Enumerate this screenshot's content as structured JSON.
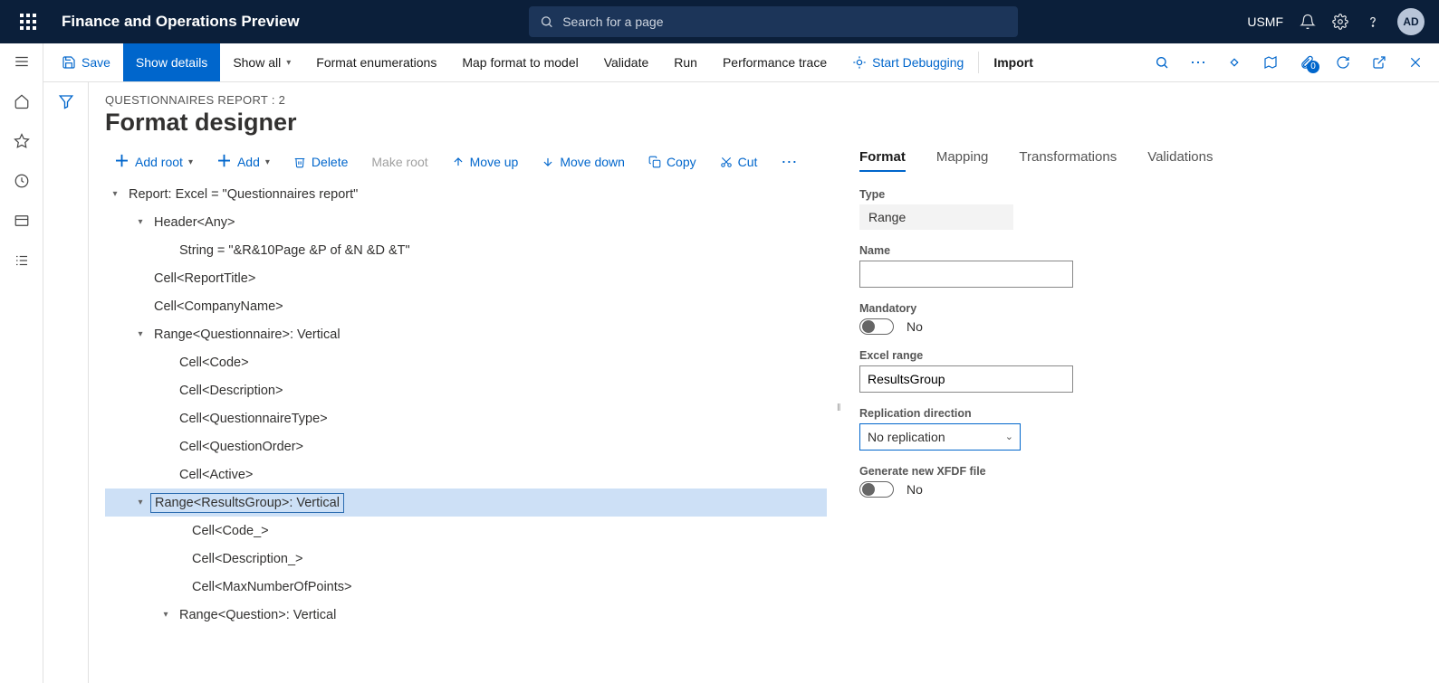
{
  "header": {
    "app_title": "Finance and Operations Preview",
    "search_placeholder": "Search for a page",
    "company": "USMF",
    "avatar": "AD"
  },
  "commandbar": {
    "save": "Save",
    "show_details": "Show details",
    "show_all": "Show all",
    "format_enum": "Format enumerations",
    "map_format": "Map format to model",
    "validate": "Validate",
    "run": "Run",
    "perf_trace": "Performance trace",
    "start_debug": "Start Debugging",
    "import": "Import",
    "attach_count": "0"
  },
  "page": {
    "breadcrumb": "QUESTIONNAIRES REPORT : 2",
    "title": "Format designer"
  },
  "tree_toolbar": {
    "add_root": "Add root",
    "add": "Add",
    "delete": "Delete",
    "make_root": "Make root",
    "move_up": "Move up",
    "move_down": "Move down",
    "copy": "Copy",
    "cut": "Cut"
  },
  "tree": {
    "n0": "Report: Excel = \"Questionnaires report\"",
    "n1": "Header<Any>",
    "n1a": "String = \"&R&10Page &P of &N &D &T\"",
    "n2": "Cell<ReportTitle>",
    "n3": "Cell<CompanyName>",
    "n4": "Range<Questionnaire>: Vertical",
    "n4a": "Cell<Code>",
    "n4b": "Cell<Description>",
    "n4c": "Cell<QuestionnaireType>",
    "n4d": "Cell<QuestionOrder>",
    "n4e": "Cell<Active>",
    "n5": "Range<ResultsGroup>: Vertical",
    "n5a": "Cell<Code_>",
    "n5b": "Cell<Description_>",
    "n5c": "Cell<MaxNumberOfPoints>",
    "n6": "Range<Question>: Vertical"
  },
  "right": {
    "tabs": {
      "format": "Format",
      "mapping": "Mapping",
      "transformations": "Transformations",
      "validations": "Validations"
    },
    "type_label": "Type",
    "type_value": "Range",
    "name_label": "Name",
    "name_value": "",
    "mandatory_label": "Mandatory",
    "mandatory_value": "No",
    "excel_range_label": "Excel range",
    "excel_range_value": "ResultsGroup",
    "replication_label": "Replication direction",
    "replication_value": "No replication",
    "xfdf_label": "Generate new XFDF file",
    "xfdf_value": "No"
  }
}
